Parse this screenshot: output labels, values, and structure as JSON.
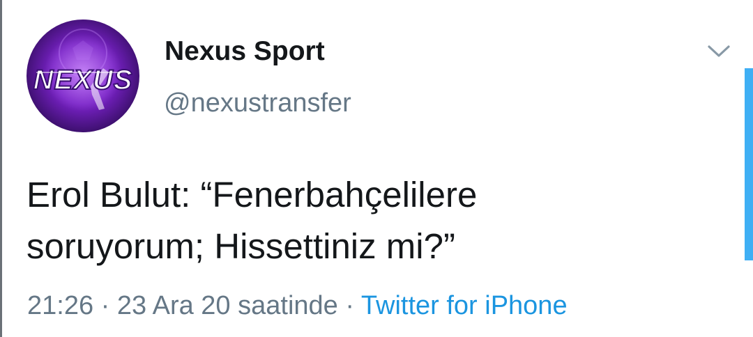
{
  "colors": {
    "name": "#14171a",
    "secondary": "#657786",
    "link": "#1b95e0",
    "accent": "#1da1f2",
    "avatar_purple": "#7a22c9"
  },
  "profile": {
    "display_name": "Nexus Sport",
    "handle": "@nexustransfer",
    "avatar_text": "NEXUS",
    "avatar_icon": "nexus-soccer-logo"
  },
  "tweet": {
    "lines": [
      "Erol Bulut: “Fenerbahçelilere",
      "soruyorum; Hissettiniz mi?”"
    ]
  },
  "meta": {
    "time": "21:26",
    "separator": "·",
    "date": "23 Ara 20 saatinde",
    "source": "Twitter for iPhone"
  },
  "icons": {
    "menu": "chevron-down-icon"
  }
}
